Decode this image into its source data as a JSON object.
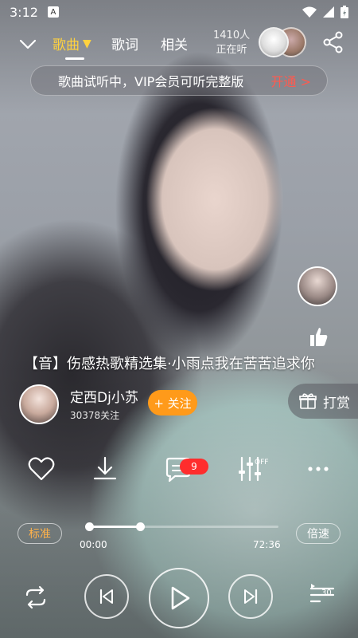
{
  "status": {
    "time": "3:12",
    "notif_letter": "A"
  },
  "nav": {
    "tabs": [
      "歌曲",
      "歌词",
      "相关"
    ],
    "active_arrow": "▼",
    "listeners_count": "1410人",
    "listeners_label": "正在听"
  },
  "vip": {
    "text": "歌曲试听中，VIP会员可听完整版",
    "action": "开通 >"
  },
  "song": {
    "title": "【音】伤感热歌精选集·小雨点我在苦苦追求你"
  },
  "artist": {
    "name": "定西Dj小苏",
    "fans": "30378关注",
    "follow_label": "+ 关注"
  },
  "tip": {
    "label": "打赏"
  },
  "actions": {
    "comment_count": "9",
    "eq_status": "OFF"
  },
  "player": {
    "quality": "标准",
    "speed": "倍速",
    "current_time": "00:00",
    "total_time": "72:36",
    "progress": 0.27,
    "playlist_count": "30"
  },
  "colors": {
    "accent": "#ffd23f",
    "follow": "#ff9a1a",
    "vip_action": "#ff5a4f",
    "badge": "#ff2d2d"
  },
  "icons": {
    "back": "chevron-down-icon",
    "share": "share-icon",
    "like": "heart-icon",
    "download": "download-icon",
    "comment": "comment-icon",
    "equalizer": "equalizer-icon",
    "more": "more-icon",
    "repeat": "repeat-icon",
    "prev": "previous-icon",
    "play": "play-icon",
    "next": "next-icon",
    "playlist": "playlist-icon",
    "gift": "gift-icon",
    "thumb": "thumbs-up-icon"
  }
}
